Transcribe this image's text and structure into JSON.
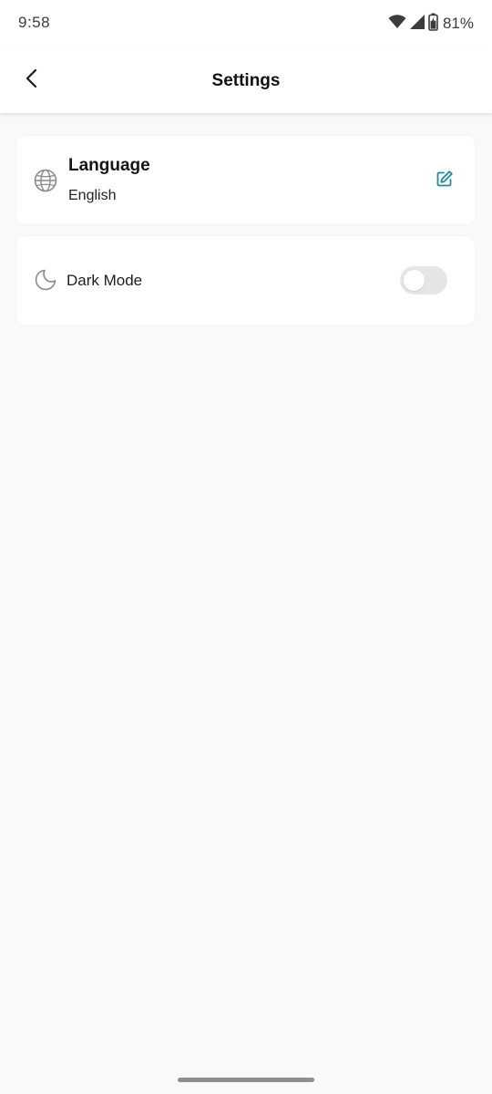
{
  "status_bar": {
    "time": "9:58",
    "battery": "81%",
    "icons": [
      "wifi-icon",
      "signal-icon",
      "battery-icon"
    ]
  },
  "app_bar": {
    "title": "Settings",
    "back_icon": "back-arrow-icon"
  },
  "settings": {
    "language": {
      "title": "Language",
      "value": "English",
      "icon": "globe-icon",
      "action_icon": "edit-icon"
    },
    "dark_mode": {
      "label": "Dark Mode",
      "icon": "moon-icon",
      "enabled": false
    }
  },
  "colors": {
    "accent": "#1e8c9b",
    "background": "#f9f9f9",
    "card": "#ffffff",
    "toggle_off": "#e6e6e6"
  }
}
